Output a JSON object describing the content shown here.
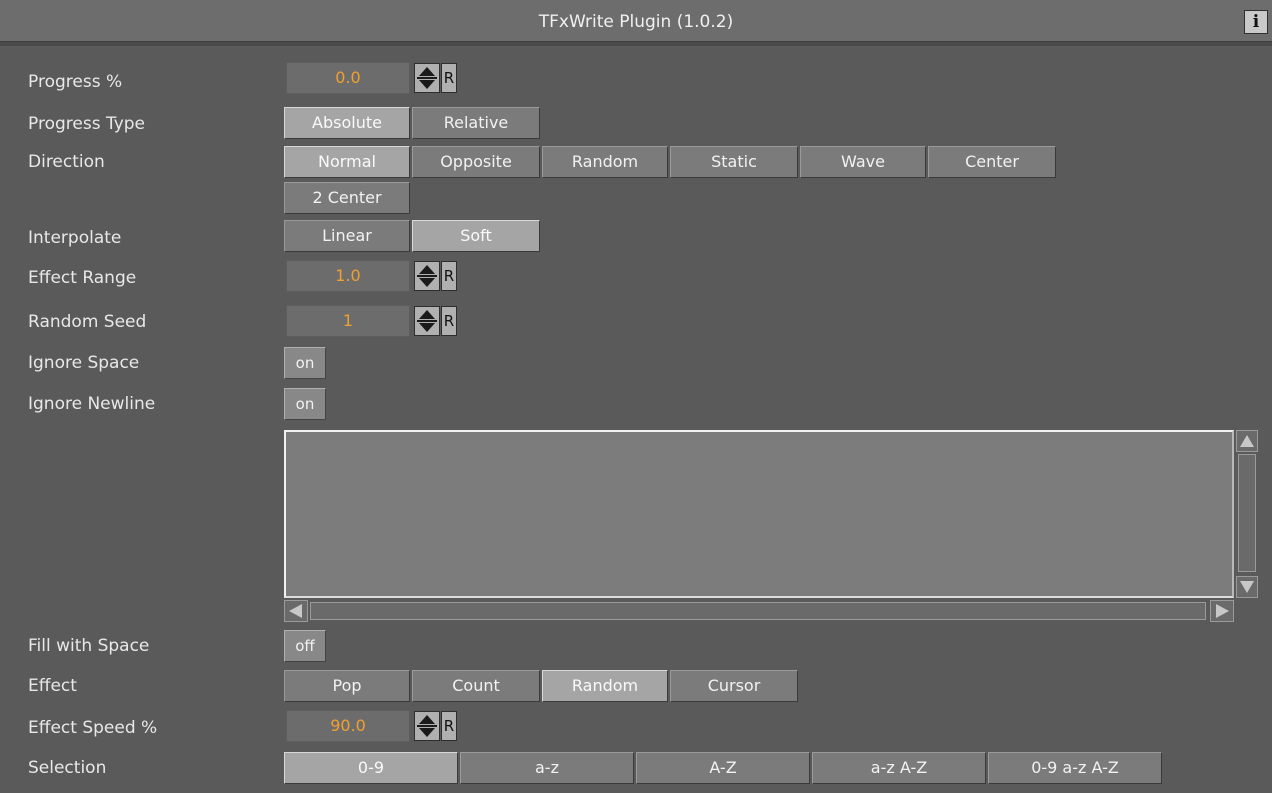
{
  "window": {
    "title": "TFxWrite Plugin (1.0.2)",
    "info_label": "i"
  },
  "progress": {
    "label": "Progress %",
    "value": "0.0",
    "reset": "R"
  },
  "progress_type": {
    "label": "Progress Type",
    "options": [
      "Absolute",
      "Relative"
    ],
    "selected": "Absolute"
  },
  "direction": {
    "label": "Direction",
    "options": [
      "Normal",
      "Opposite",
      "Random",
      "Static",
      "Wave",
      "Center",
      "2 Center"
    ],
    "selected": "Normal"
  },
  "interpolate": {
    "label": "Interpolate",
    "options": [
      "Linear",
      "Soft"
    ],
    "selected": "Soft"
  },
  "effect_range": {
    "label": "Effect Range",
    "value": "1.0",
    "reset": "R"
  },
  "random_seed": {
    "label": "Random Seed",
    "value": "1",
    "reset": "R"
  },
  "ignore_space": {
    "label": "Ignore Space",
    "value": "on"
  },
  "ignore_newline": {
    "label": "Ignore Newline",
    "value": "on"
  },
  "text_area": {
    "value": ""
  },
  "fill_with_space": {
    "label": "Fill with Space",
    "value": "off"
  },
  "effect": {
    "label": "Effect",
    "options": [
      "Pop",
      "Count",
      "Random",
      "Cursor"
    ],
    "selected": "Random"
  },
  "effect_speed": {
    "label": "Effect Speed %",
    "value": "90.0",
    "reset": "R"
  },
  "selection": {
    "label": "Selection",
    "options": [
      "0-9",
      "a-z",
      "A-Z",
      "a-z A-Z",
      "0-9 a-z A-Z"
    ],
    "selected": "0-9"
  },
  "colors": {
    "background": "#5a5a5a",
    "value_text": "#f0a030",
    "button": "#7b7b7b",
    "button_active": "#a5a5a5"
  }
}
